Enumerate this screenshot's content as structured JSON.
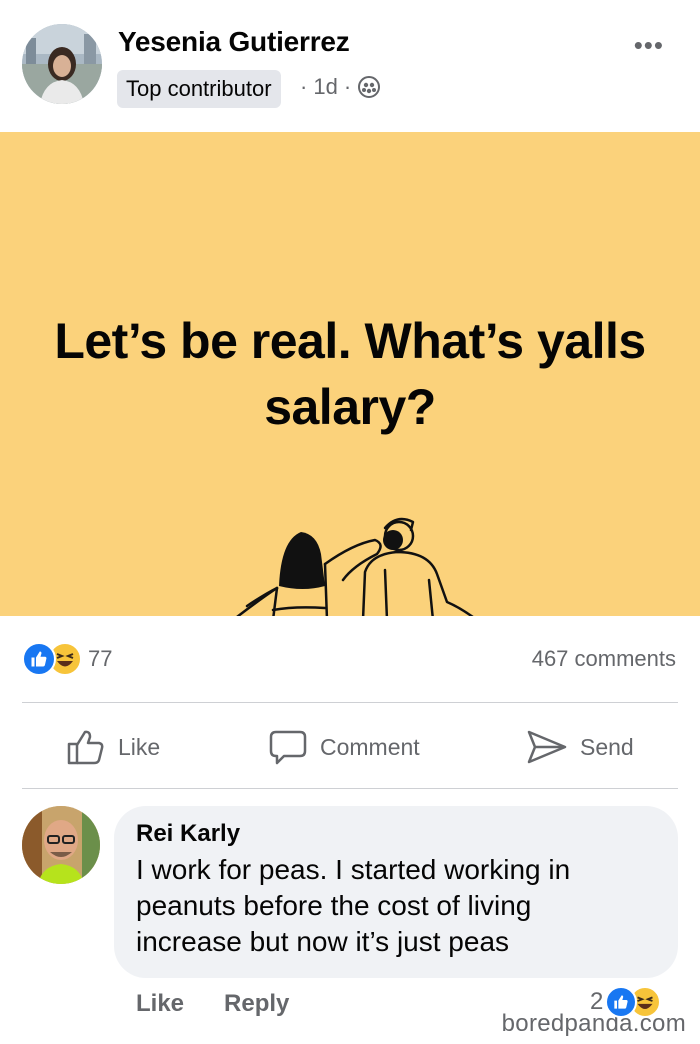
{
  "post": {
    "author": "Yesenia Gutierrez",
    "badge": "Top contributor",
    "time": "1d",
    "separator": "·",
    "more_label": "•••",
    "image_text": "Let’s be real. What’s yalls salary?",
    "background_color": "#fbd27b",
    "audience_icon": "friends-icon"
  },
  "engagement": {
    "reaction_count": "77",
    "comments_count": "467 comments",
    "reactions": [
      "like-reaction-icon",
      "haha-reaction-icon"
    ]
  },
  "actions": {
    "like_label": "Like",
    "comment_label": "Comment",
    "send_label": "Send"
  },
  "comment": {
    "author": "Rei Karly",
    "text": "I work for peas. I started working in peanuts before the cost of living increase but now it’s just peas",
    "like_label": "Like",
    "reply_label": "Reply",
    "reaction_count": "2"
  },
  "watermark": "boredpanda.com",
  "colors": {
    "accent": "#1877f2",
    "haha": "#f7c43a",
    "secondary_text": "#65676b"
  }
}
